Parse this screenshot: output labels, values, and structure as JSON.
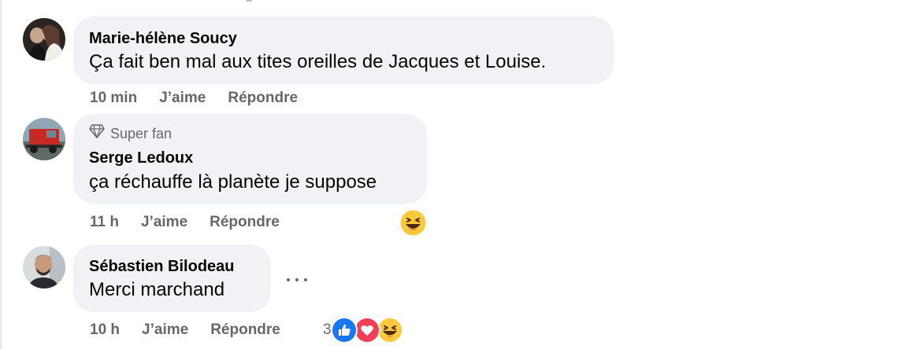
{
  "comments": [
    {
      "author": "Marie-hélène Soucy",
      "text": "Ça fait ben mal aux tites oreilles de Jacques et Louise.",
      "time": "10 min",
      "like_label": "J’aime",
      "reply_label": "Répondre"
    },
    {
      "badge": "Super fan",
      "badge_icon": "diamond-icon",
      "author": "Serge Ledoux",
      "text": "ça réchauffe là planète je suppose",
      "time": "11 h",
      "like_label": "J’aime",
      "reply_label": "Répondre",
      "reactions": [
        "haha"
      ]
    },
    {
      "author": "Sébastien Bilodeau",
      "text": "Merci marchand",
      "time": "10 h",
      "like_label": "J’aime",
      "reply_label": "Répondre",
      "reaction_count": "3",
      "reactions": [
        "like",
        "love",
        "haha"
      ],
      "menu_icon": "more-options-icon"
    }
  ],
  "colors": {
    "bubble": "#f0f2f5",
    "meta_text": "#65676b",
    "like_blue": "#1877f2",
    "love_red": "#f33e58",
    "haha_yellow": "#fcc83c"
  }
}
